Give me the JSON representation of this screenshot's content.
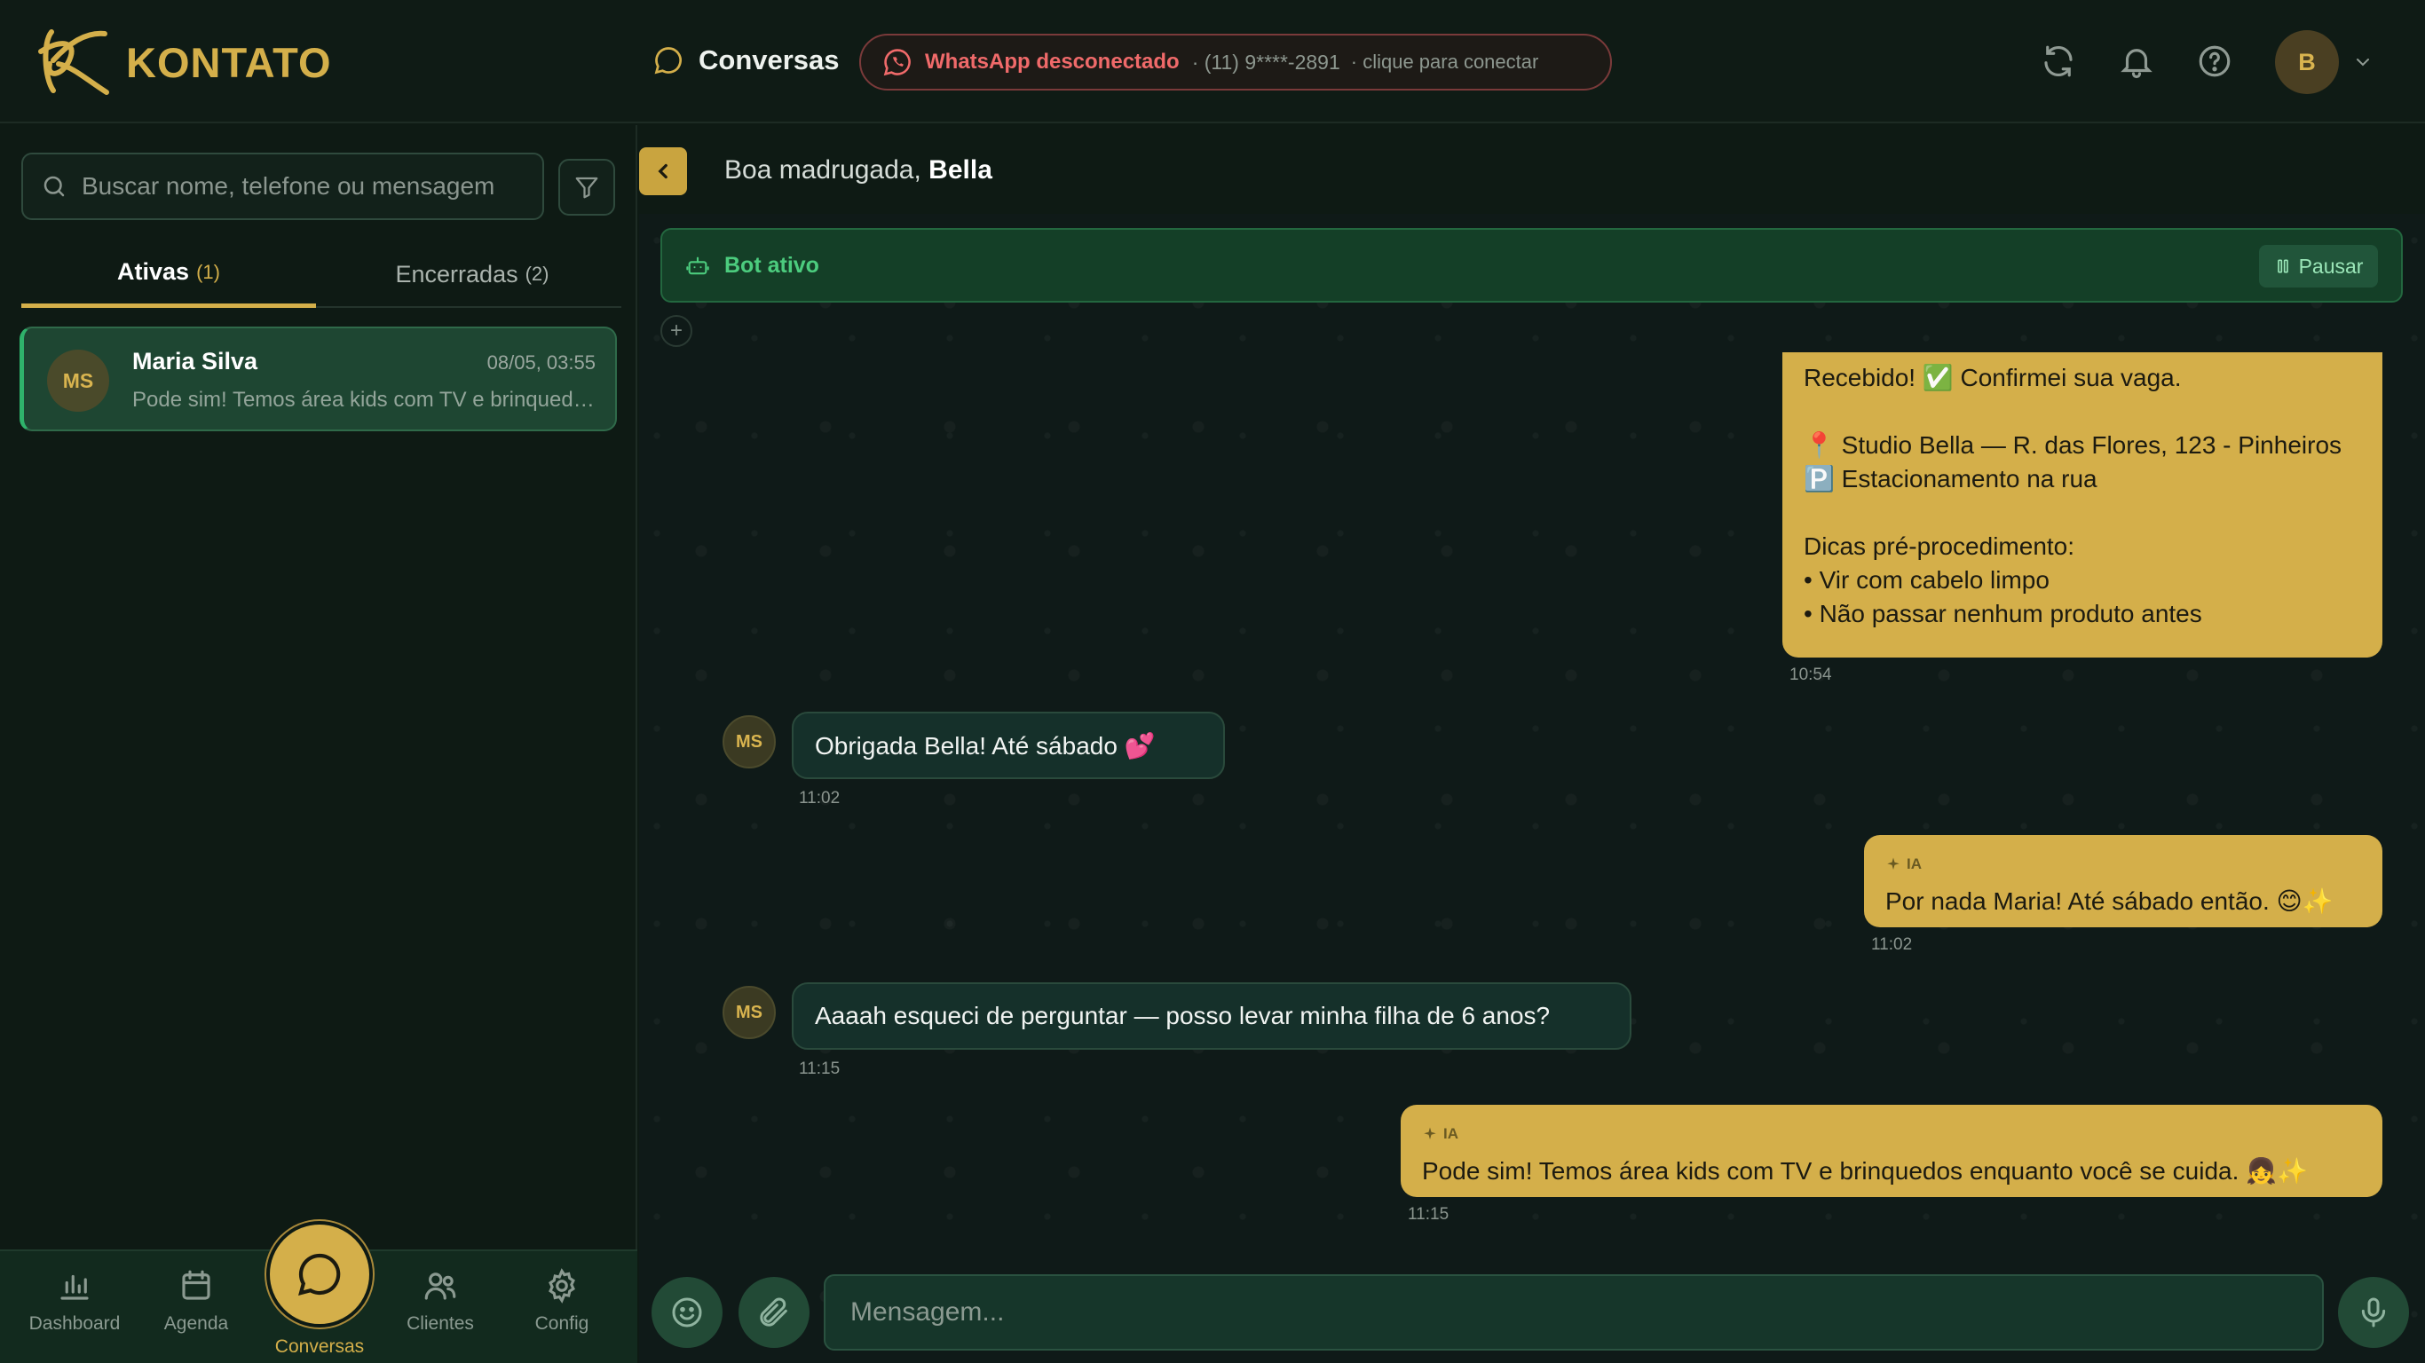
{
  "header": {
    "brand": "KONTATO",
    "section_title": "Conversas",
    "whatsapp": {
      "status": "WhatsApp desconectado",
      "phone": "· (11) 9****-2891",
      "cta": "· clique para conectar"
    },
    "user_initial": "B",
    "icons": [
      "refresh-icon",
      "bell-icon",
      "help-icon",
      "chevron-down-icon"
    ]
  },
  "sidebar": {
    "search_placeholder": "Buscar nome, telefone ou mensagem",
    "tabs": [
      {
        "label": "Ativas",
        "count": "(1)"
      },
      {
        "label": "Encerradas",
        "count": "(2)"
      }
    ],
    "conversations": [
      {
        "initials": "MS",
        "name": "Maria Silva",
        "time": "08/05, 03:55",
        "preview": "Pode sim! Temos área kids com TV e brinquedos enquanto você se cuida. 👧✨"
      }
    ]
  },
  "bottom_nav": {
    "items": [
      {
        "label": "Dashboard",
        "icon": "bar-chart-icon"
      },
      {
        "label": "Agenda",
        "icon": "calendar-icon"
      },
      {
        "label": "Conversas",
        "icon": "chat-bubble-icon"
      },
      {
        "label": "Clientes",
        "icon": "users-icon"
      },
      {
        "label": "Config",
        "icon": "gear-icon"
      }
    ]
  },
  "chat": {
    "greeting_prefix": "Boa madrugada,",
    "greeting_name": "Bella",
    "bot_status": "Bot ativo",
    "pause_label": "Pausar",
    "messages": [
      {
        "direction": "out",
        "lines": [
          "Recebido! ✅ Confirmei sua vaga.",
          "",
          "📍 Studio Bella — R. das Flores, 123 - Pinheiros",
          "🅿️ Estacionamento na rua",
          "",
          "Dicas pré-procedimento:",
          "• Vir com cabelo limpo",
          "• Não passar nenhum produto antes"
        ],
        "time": "10:54"
      },
      {
        "direction": "in",
        "initials": "MS",
        "text": "Obrigada Bella! Até sábado 💕",
        "time": "11:02"
      },
      {
        "direction": "out",
        "tag": "IA",
        "text": "Por nada Maria! Até sábado então. 😊✨",
        "time": "11:02"
      },
      {
        "direction": "in",
        "initials": "MS",
        "text": "Aaaah esqueci de perguntar — posso levar minha filha de 6 anos?",
        "time": "11:15"
      },
      {
        "direction": "out",
        "tag": "IA",
        "text": "Pode sim! Temos área kids com TV e brinquedos enquanto você se cuida. 👧✨",
        "time": "11:15"
      }
    ],
    "composer_placeholder": "Mensagem..."
  },
  "colors": {
    "accent_gold": "#d4af4a",
    "bot_green": "#4ccc7e",
    "disconnected_red": "#f06a6a"
  }
}
